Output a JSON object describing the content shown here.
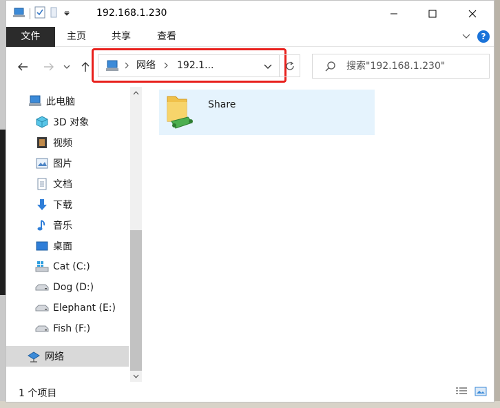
{
  "window": {
    "title": "192.168.1.230"
  },
  "ribbon": {
    "tabs": [
      "文件",
      "主页",
      "共享",
      "查看"
    ],
    "help_label": "?"
  },
  "nav": {
    "address": [
      "网络",
      "192.1..."
    ],
    "search_placeholder": "搜索\"192.168.1.230\""
  },
  "sidebar": {
    "items": [
      {
        "label": "此电脑",
        "icon": "computer-icon"
      },
      {
        "label": "3D 对象",
        "icon": "cube-icon"
      },
      {
        "label": "视频",
        "icon": "video-icon"
      },
      {
        "label": "图片",
        "icon": "pictures-icon"
      },
      {
        "label": "文档",
        "icon": "document-icon"
      },
      {
        "label": "下载",
        "icon": "download-icon"
      },
      {
        "label": "音乐",
        "icon": "music-icon"
      },
      {
        "label": "桌面",
        "icon": "desktop-icon"
      },
      {
        "label": "Cat (C:)",
        "icon": "windows-drive-icon"
      },
      {
        "label": "Dog (D:)",
        "icon": "drive-icon"
      },
      {
        "label": "Elephant (E:)",
        "icon": "drive-icon"
      },
      {
        "label": "Fish (F:)",
        "icon": "drive-icon"
      },
      {
        "label": "网络",
        "icon": "network-icon"
      }
    ],
    "selected": "网络"
  },
  "content": {
    "items": [
      {
        "name": "Share",
        "icon": "shared-folder-icon"
      }
    ]
  },
  "status": {
    "item_count": "1 个项目"
  },
  "colors": {
    "file_tab": "#2b2b2b",
    "highlight_box": "#e8201c",
    "selected_tile": "#e5f3fd",
    "help": "#1a73d9"
  }
}
